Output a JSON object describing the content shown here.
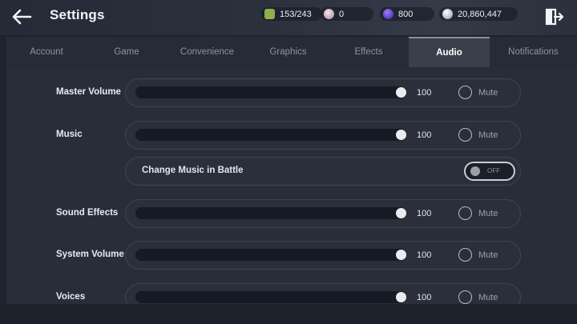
{
  "header": {
    "title": "Settings",
    "back_icon": "back-arrow-icon",
    "exit_icon": "exit-door-icon"
  },
  "currencies": [
    {
      "name": "stamina",
      "icon": "stamina-icon",
      "color": "#8fb04a",
      "value": "153/243"
    },
    {
      "name": "gold",
      "icon": "gold-coin-icon",
      "color": "#c9a9b8",
      "value": "0"
    },
    {
      "name": "gems",
      "icon": "purple-gem-icon",
      "color": "#5a3cc0",
      "value": "800"
    },
    {
      "name": "silver",
      "icon": "silver-coin-icon",
      "color": "#b8c4d4",
      "value": "20,860,447"
    }
  ],
  "tabs": [
    {
      "label": "Account",
      "active": false
    },
    {
      "label": "Game",
      "active": false
    },
    {
      "label": "Convenience",
      "active": false
    },
    {
      "label": "Graphics",
      "active": false
    },
    {
      "label": "Effects",
      "active": false
    },
    {
      "label": "Audio",
      "active": true
    },
    {
      "label": "Notifications",
      "active": false
    }
  ],
  "settings": {
    "master_volume": {
      "label": "Master Volume",
      "value": "100",
      "level": 1.0,
      "mute_label": "Mute",
      "muted": false
    },
    "music": {
      "label": "Music",
      "value": "100",
      "level": 1.0,
      "mute_label": "Mute",
      "muted": false
    },
    "change_music_in_battle": {
      "label": "Change Music in Battle",
      "state": "OFF"
    },
    "sound_effects": {
      "label": "Sound Effects",
      "value": "100",
      "level": 1.0,
      "mute_label": "Mute",
      "muted": false
    },
    "system_volume": {
      "label": "System Volume",
      "value": "100",
      "level": 1.0,
      "mute_label": "Mute",
      "muted": false
    },
    "voices": {
      "label": "Voices",
      "value": "100",
      "level": 1.0,
      "mute_label": "Mute",
      "muted": false
    }
  },
  "colors": {
    "background": "#1f232f",
    "panel_border": "#3f4452",
    "track": "#161a24",
    "active_tab": "#3a3f4c",
    "text": "#e9ebf0"
  }
}
